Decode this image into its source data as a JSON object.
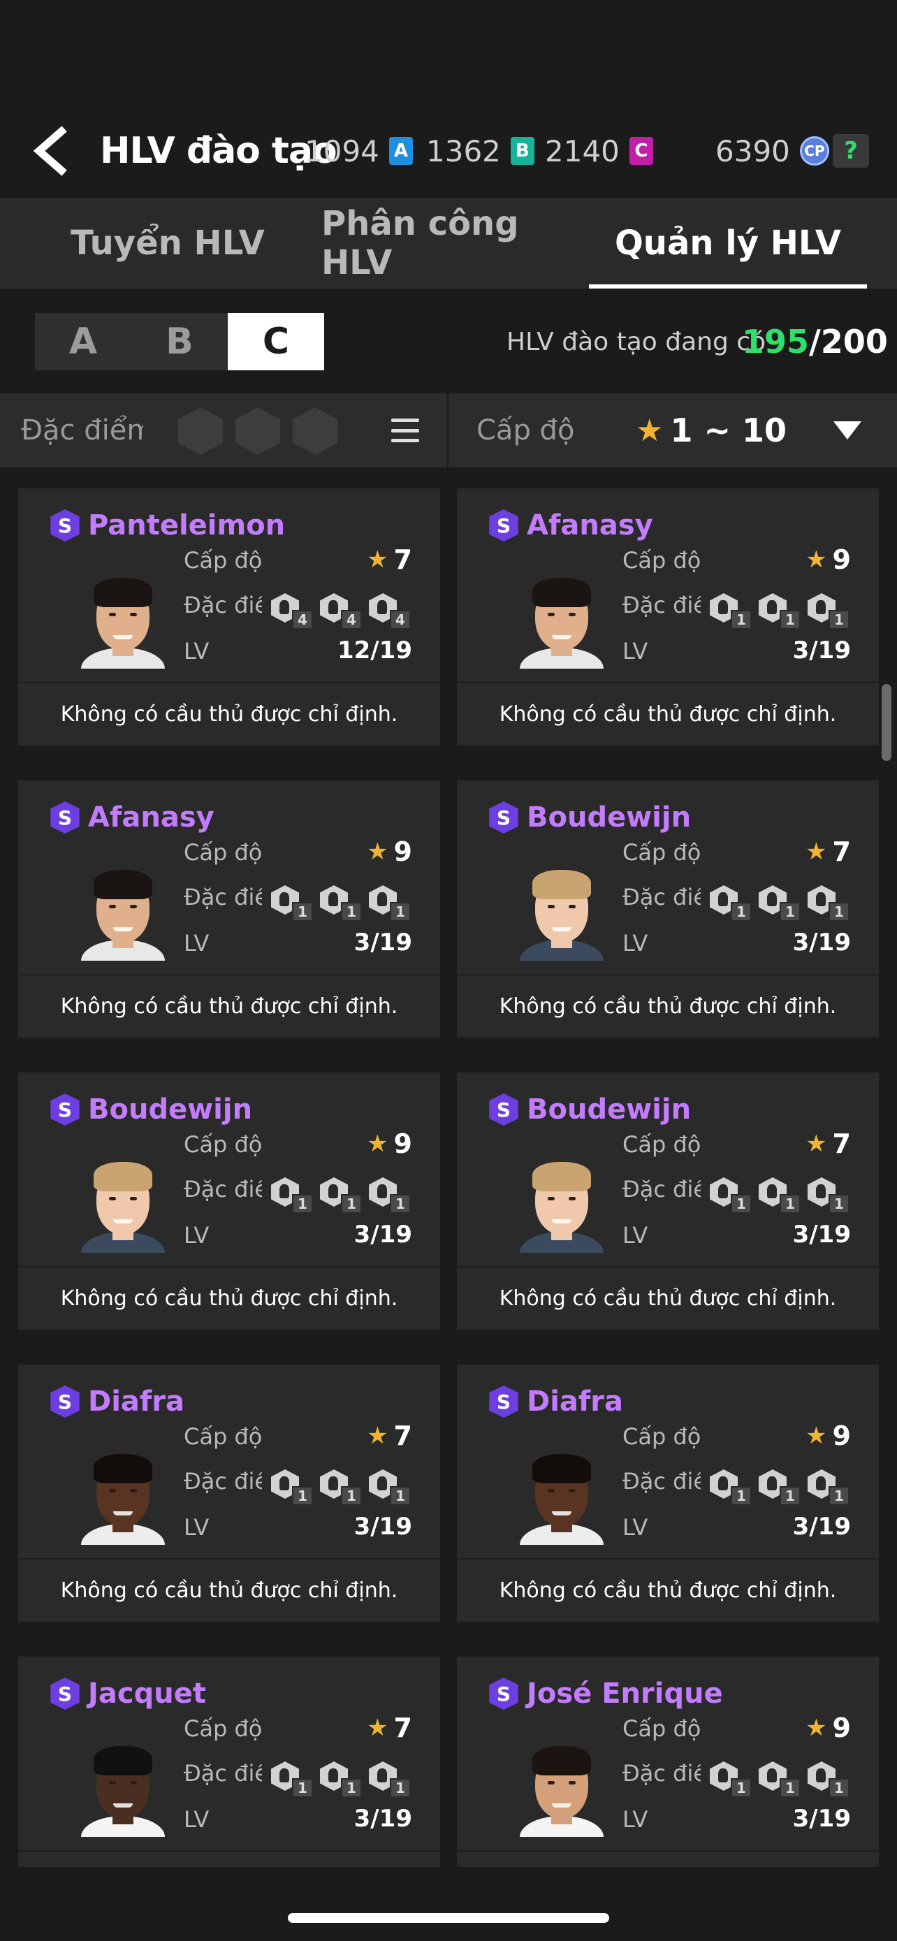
{
  "header": {
    "title": "HLV đào tạo",
    "back_icon": "chevron-left-icon",
    "currencies": [
      {
        "value": "1094",
        "badge": "A",
        "color": "#1f8fe0"
      },
      {
        "value": "1362",
        "badge": "B",
        "color": "#16b39a"
      },
      {
        "value": "2140",
        "badge": "C",
        "color": "#c21fa8"
      },
      {
        "value": "6390",
        "badge": "CP",
        "color": "#5a7fd8"
      }
    ],
    "help_label": "?"
  },
  "tabs": [
    {
      "label": "Tuyển HLV"
    },
    {
      "label": "Phân công  HLV"
    },
    {
      "label": "Quản lý HLV",
      "active": true
    }
  ],
  "grades": [
    {
      "label": "A"
    },
    {
      "label": "B"
    },
    {
      "label": "C",
      "active": true
    }
  ],
  "coach_count": {
    "label": "HLV đào tạo đang có",
    "current": "195",
    "total": "/200"
  },
  "filter": {
    "trait_label": "Đặc điểm đ",
    "level_label": "Cấp độ",
    "level_range": "1 ~ 10"
  },
  "card_labels": {
    "level": "Cấp độ",
    "trait": "Đặc điểm",
    "lv": "LV"
  },
  "cards": [
    {
      "name": "Panteleimon",
      "level": "7",
      "lv": "12/19",
      "traits": [
        "4",
        "4",
        "4"
      ],
      "note": "Không có cầu thủ được chỉ định."
    },
    {
      "name": "Afanasy",
      "level": "9",
      "lv": "3/19",
      "traits": [
        "1",
        "1",
        "1"
      ],
      "note": "Không có cầu thủ được chỉ định."
    },
    {
      "name": "Afanasy",
      "level": "9",
      "lv": "3/19",
      "traits": [
        "1",
        "1",
        "1"
      ],
      "note": "Không có cầu thủ được chỉ định."
    },
    {
      "name": "Boudewijn",
      "level": "7",
      "lv": "3/19",
      "traits": [
        "1",
        "1",
        "1"
      ],
      "note": "Không có cầu thủ được chỉ định."
    },
    {
      "name": "Boudewijn",
      "level": "9",
      "lv": "3/19",
      "traits": [
        "1",
        "1",
        "1"
      ],
      "note": "Không có cầu thủ được chỉ định."
    },
    {
      "name": "Boudewijn",
      "level": "7",
      "lv": "3/19",
      "traits": [
        "1",
        "1",
        "1"
      ],
      "note": "Không có cầu thủ được chỉ định."
    },
    {
      "name": "Diafra",
      "level": "7",
      "lv": "3/19",
      "traits": [
        "1",
        "1",
        "1"
      ],
      "note": "Không có cầu thủ được chỉ định."
    },
    {
      "name": "Diafra",
      "level": "9",
      "lv": "3/19",
      "traits": [
        "1",
        "1",
        "1"
      ],
      "note": "Không có cầu thủ được chỉ định."
    },
    {
      "name": "Jacquet",
      "level": "7",
      "lv": "3/19",
      "traits": [
        "1",
        "1",
        "1"
      ],
      "note": ""
    },
    {
      "name": "José Enrique",
      "level": "9",
      "lv": "3/19",
      "traits": [
        "1",
        "1",
        "1"
      ],
      "note": ""
    }
  ]
}
